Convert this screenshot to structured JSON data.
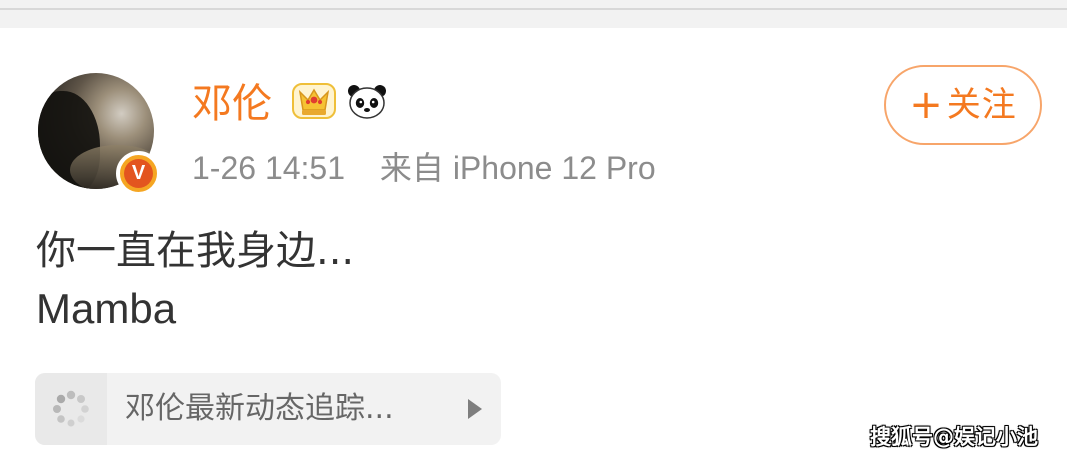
{
  "post": {
    "username": "邓伦",
    "badges": [
      "crown-icon",
      "panda-icon"
    ],
    "timestamp": "1-26 14:51",
    "source_prefix": "来自",
    "source_device": "iPhone 12 Pro",
    "follow_button": {
      "plus": "+",
      "label": "关注"
    },
    "verified_badge": "V",
    "content_lines": [
      "你一直在我身边...",
      "Mamba"
    ],
    "topic_card": {
      "icon": "loader-icon",
      "title": "邓伦最新动态追踪...",
      "arrow": "play-arrow-icon"
    }
  },
  "watermark": "搜狐号@娱记小池",
  "colors": {
    "accent": "#f47920",
    "meta": "#8c8c8c",
    "content": "#333333",
    "card_bg": "#f2f2f2"
  }
}
